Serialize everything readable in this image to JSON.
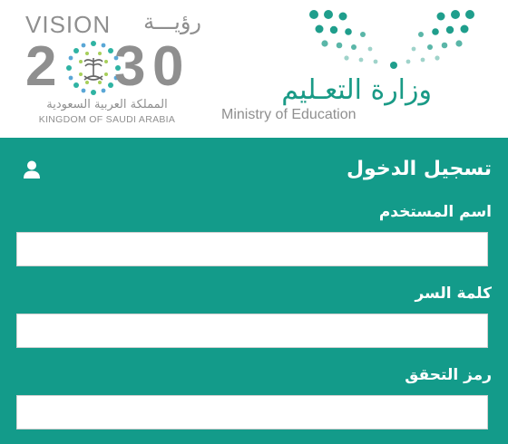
{
  "header": {
    "vision_logo": {
      "word": "VISION",
      "word_ar": "رؤيـــة",
      "year_digits": [
        "2",
        "3",
        "0"
      ],
      "subtitle_ar": "المملكة العربية السعودية",
      "subtitle_en": "KINGDOM OF SAUDI ARABIA",
      "emblem": "palm-swords-emblem-icon"
    },
    "ministry_logo": {
      "name_ar": "وزارة التعـليم",
      "name_en": "Ministry of Education",
      "mark": "dot-pattern-logo-icon"
    }
  },
  "login": {
    "title": "تسجيل الدخول",
    "title_icon": "user-icon",
    "fields": [
      {
        "label": "اسم المستخدم",
        "value": "",
        "placeholder": ""
      },
      {
        "label": "كلمة السر",
        "value": "",
        "placeholder": ""
      },
      {
        "label": "رمز التحقق",
        "value": "",
        "placeholder": ""
      }
    ]
  },
  "colors": {
    "teal": "#139b8a",
    "teal_text": "#1a9a86",
    "gray": "#8f8f8f",
    "white": "#ffffff"
  }
}
